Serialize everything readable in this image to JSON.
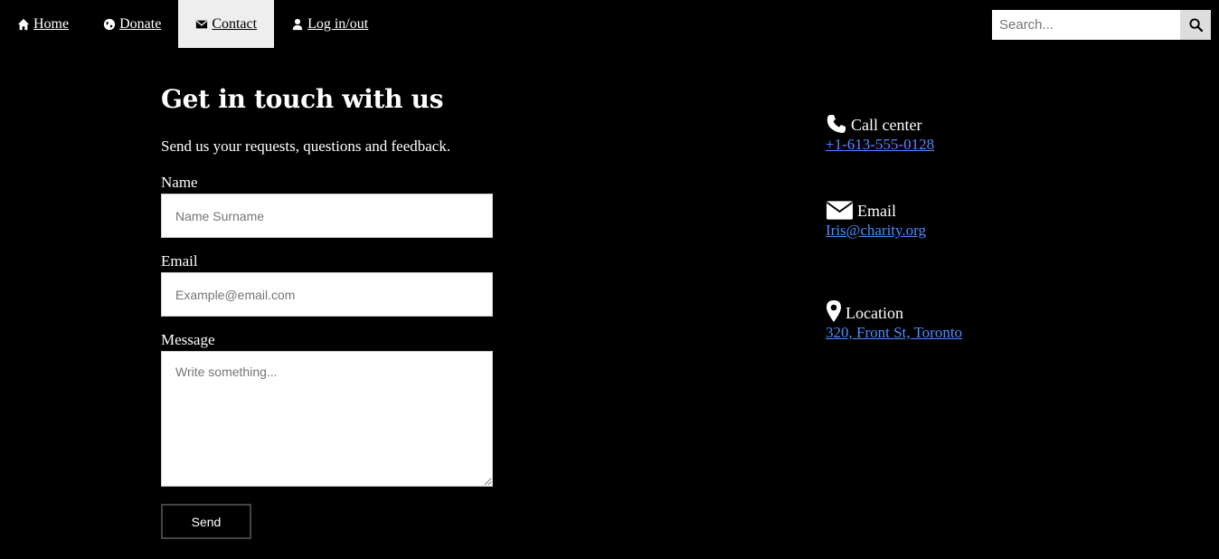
{
  "nav": {
    "items": [
      {
        "label": "Home",
        "icon": "home-icon"
      },
      {
        "label": "Donate",
        "icon": "globe-icon"
      },
      {
        "label": "Contact",
        "icon": "envelope-icon",
        "active": true
      },
      {
        "label": "Log in/out",
        "icon": "user-icon"
      }
    ]
  },
  "search": {
    "placeholder": "Search...",
    "button_icon": "search-icon"
  },
  "main": {
    "title": "Get in touch with us",
    "subtitle": "Send us your requests, questions and feedback.",
    "form": {
      "name_label": "Name",
      "name_placeholder": "Name Surname",
      "email_label": "Email",
      "email_placeholder": "Example@email.com",
      "message_label": "Message",
      "message_placeholder": "Write something...",
      "send_label": "Send"
    }
  },
  "contact_info": {
    "call": {
      "icon": "phone-icon",
      "label": "Call center",
      "value": "+1-613-555-0128"
    },
    "email": {
      "icon": "envelope-icon",
      "label": "Email",
      "value": "Iris@charity.org"
    },
    "location": {
      "icon": "map-marker-icon",
      "label": "Location",
      "value": "320, Front St, Toronto"
    }
  },
  "colors": {
    "background": "#000000",
    "text": "#ffffff",
    "active_tab": "#eeeeee",
    "link": "#4d8cff",
    "search_button": "#dddddd"
  }
}
